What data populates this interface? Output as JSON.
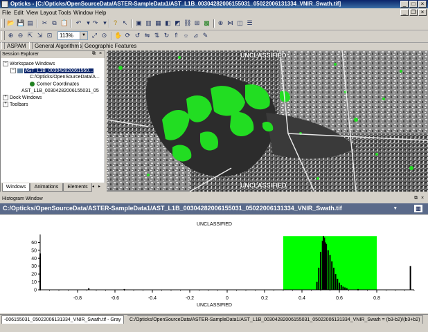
{
  "window": {
    "title": "Opticks - [C:/Opticks/OpenSourceData/ASTER-SampleData1/AST_L1B_00304282006155031_05022006131334_VNIR_Swath.tif]"
  },
  "menu": [
    "File",
    "Edit",
    "View",
    "Layout",
    "Tools",
    "Window",
    "Help"
  ],
  "toolbar": {
    "zoom_value": "113%",
    "plugins": [
      "ASPAM",
      "General Algorithms",
      "Geographic Features"
    ]
  },
  "session_explorer": {
    "title": "Session Explorer",
    "tree": {
      "workspace": "Workspace Windows",
      "view": "AST_L1B_003042820061550...",
      "file": "C:/Opticks/OpenSourceData/A...",
      "corner": "Corner Coordinates",
      "layer": "AST_L1B_00304282006155031_05",
      "dock": "Dock Windows",
      "toolbars": "Toolbars"
    },
    "tabs": [
      "Windows",
      "Animations",
      "Elements"
    ]
  },
  "image_view": {
    "top_label": "UNCLASSIFIED",
    "bottom_label": "UNCLASSIFIED"
  },
  "histogram": {
    "window_title": "Histogram Window",
    "path": "C:/Opticks/OpenSourceData/ASTER-SampleData1/AST_L1B_00304282006155031_05022006131334_VNIR_Swath.tif",
    "top_label": "UNCLASSIFIED",
    "bottom_label": "UNCLASSIFIED"
  },
  "status": {
    "left_tab": "-006155031_05022006131334_VNIR_Swath.tif - Gray",
    "right_tab": "C:/Opticks/OpenSourceData/ASTER-SampleData1/AST_L1B_00304282006155031_05022006131334_VNIR_Swath = (b3-b2)/(b3+b2)"
  },
  "colors": {
    "title_bar": "#0a246a",
    "histogram_header": "#5a6a8a",
    "highlight": "#00ff00"
  },
  "chart_data": {
    "type": "bar",
    "title": "",
    "xlabel": "",
    "ylabel": "",
    "xlim": [
      -1.0,
      1.0
    ],
    "ylim": [
      0,
      70
    ],
    "x_ticks": [
      -0.8,
      -0.6,
      -0.4,
      -0.2,
      0,
      0.2,
      0.4,
      0.6,
      0.8
    ],
    "x_tick_labels": [
      "-0.8",
      "-0.6",
      "-0.4",
      "-0.2",
      "0",
      "0.2",
      "0.4",
      "0.6",
      "0.8"
    ],
    "y_ticks": [
      0,
      10,
      20,
      30,
      40,
      50,
      60
    ],
    "y_tick_labels": [
      "0",
      "10",
      "20",
      "30",
      "40",
      "50",
      "60"
    ],
    "selection_range": [
      0.3,
      0.8
    ],
    "bins": [
      {
        "x": -1.0,
        "y": 46
      },
      {
        "x": -0.74,
        "y": 2
      },
      {
        "x": -0.55,
        "y": 1
      },
      {
        "x": 0.48,
        "y": 10
      },
      {
        "x": 0.49,
        "y": 28
      },
      {
        "x": 0.5,
        "y": 48
      },
      {
        "x": 0.51,
        "y": 62
      },
      {
        "x": 0.515,
        "y": 68
      },
      {
        "x": 0.52,
        "y": 66
      },
      {
        "x": 0.525,
        "y": 60
      },
      {
        "x": 0.53,
        "y": 58
      },
      {
        "x": 0.54,
        "y": 50
      },
      {
        "x": 0.55,
        "y": 44
      },
      {
        "x": 0.56,
        "y": 36
      },
      {
        "x": 0.57,
        "y": 28
      },
      {
        "x": 0.58,
        "y": 20
      },
      {
        "x": 0.59,
        "y": 14
      },
      {
        "x": 0.6,
        "y": 9
      },
      {
        "x": 0.61,
        "y": 6
      },
      {
        "x": 0.62,
        "y": 4
      },
      {
        "x": 0.63,
        "y": 3
      },
      {
        "x": 0.64,
        "y": 2
      },
      {
        "x": 0.7,
        "y": 1
      },
      {
        "x": 0.98,
        "y": 30
      }
    ]
  }
}
